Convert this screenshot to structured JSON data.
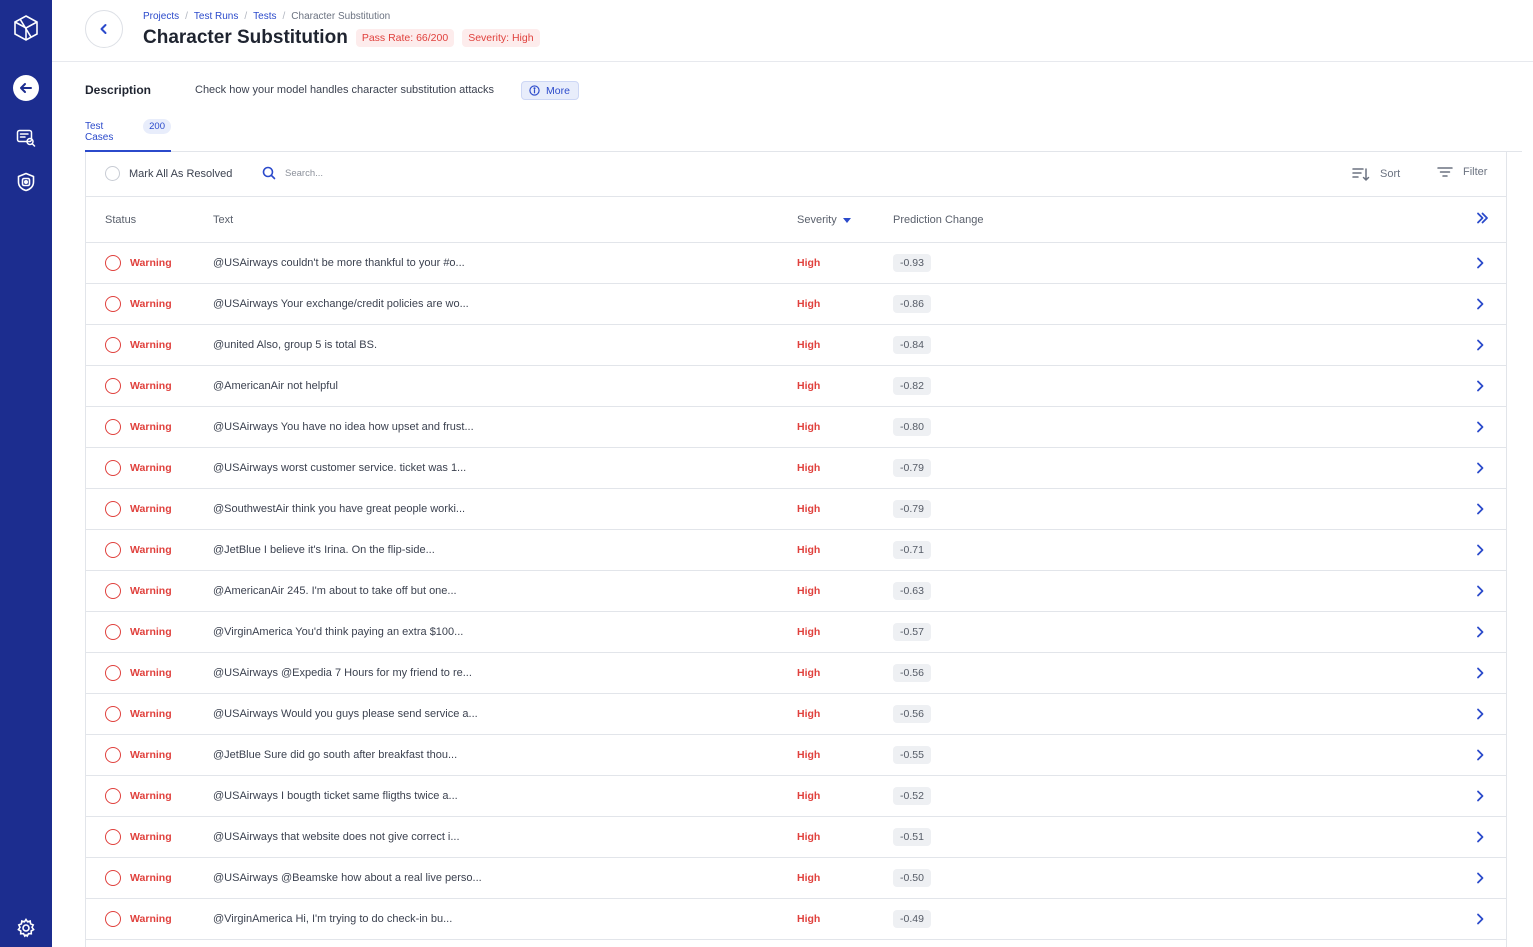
{
  "sidebar": {
    "icons": [
      "logo-icon",
      "back-arrow-icon",
      "search-list-icon",
      "shield-icon",
      "gear-icon"
    ]
  },
  "header": {
    "breadcrumb": [
      "Projects",
      "Test Runs",
      "Tests",
      "Character Substitution"
    ],
    "title": "Character Substitution",
    "pass_rate": "Pass Rate: 66/200",
    "severity": "Severity: High"
  },
  "description": {
    "label": "Description",
    "text": "Check how your model handles character substitution attacks",
    "more_label": "More"
  },
  "tabs": {
    "test_cases_label": "Test Cases",
    "test_cases_count": "200"
  },
  "toolbar": {
    "mark_all_label": "Mark All As Resolved",
    "search_placeholder": "Search...",
    "sort_label": "Sort",
    "filter_label": "Filter"
  },
  "table": {
    "columns": {
      "status": "Status",
      "text": "Text",
      "severity": "Severity",
      "prediction_change": "Prediction Change"
    },
    "rows": [
      {
        "status": "Warning",
        "text": "@USAirways couldn't be more thankful to your #o...",
        "severity": "High",
        "pred": "-0.93"
      },
      {
        "status": "Warning",
        "text": "@USAirways Your exchange/credit policies are wo...",
        "severity": "High",
        "pred": "-0.86"
      },
      {
        "status": "Warning",
        "text": "@united Also, group 5 is total BS.",
        "severity": "High",
        "pred": "-0.84"
      },
      {
        "status": "Warning",
        "text": "@AmericanAir not helpful",
        "severity": "High",
        "pred": "-0.82"
      },
      {
        "status": "Warning",
        "text": "@USAirways You have no idea how upset and frust...",
        "severity": "High",
        "pred": "-0.80"
      },
      {
        "status": "Warning",
        "text": "@USAirways worst customer service. ticket was 1...",
        "severity": "High",
        "pred": "-0.79"
      },
      {
        "status": "Warning",
        "text": "@SouthwestAir think you have great people worki...",
        "severity": "High",
        "pred": "-0.79"
      },
      {
        "status": "Warning",
        "text": "@JetBlue I believe it's Irina. On the flip-side...",
        "severity": "High",
        "pred": "-0.71"
      },
      {
        "status": "Warning",
        "text": "@AmericanAir 245. I'm about to take off but one...",
        "severity": "High",
        "pred": "-0.63"
      },
      {
        "status": "Warning",
        "text": "@VirginAmerica You'd think paying an extra $100...",
        "severity": "High",
        "pred": "-0.57"
      },
      {
        "status": "Warning",
        "text": "@USAirways @Expedia 7 Hours for my friend to re...",
        "severity": "High",
        "pred": "-0.56"
      },
      {
        "status": "Warning",
        "text": "@USAirways Would you guys please send service a...",
        "severity": "High",
        "pred": "-0.56"
      },
      {
        "status": "Warning",
        "text": "@JetBlue Sure did go south after breakfast thou...",
        "severity": "High",
        "pred": "-0.55"
      },
      {
        "status": "Warning",
        "text": "@USAirways I bougth ticket same fligths twice a...",
        "severity": "High",
        "pred": "-0.52"
      },
      {
        "status": "Warning",
        "text": "@USAirways that website does not give correct i...",
        "severity": "High",
        "pred": "-0.51"
      },
      {
        "status": "Warning",
        "text": "@USAirways @Beamske how about a real live perso...",
        "severity": "High",
        "pred": "-0.50"
      },
      {
        "status": "Warning",
        "text": "@VirginAmerica Hi, I'm trying to do check-in bu...",
        "severity": "High",
        "pred": "-0.49"
      }
    ]
  },
  "colors": {
    "sidebar": "#1c2d8f",
    "accent": "#2b4acb",
    "danger": "#e0413d"
  }
}
